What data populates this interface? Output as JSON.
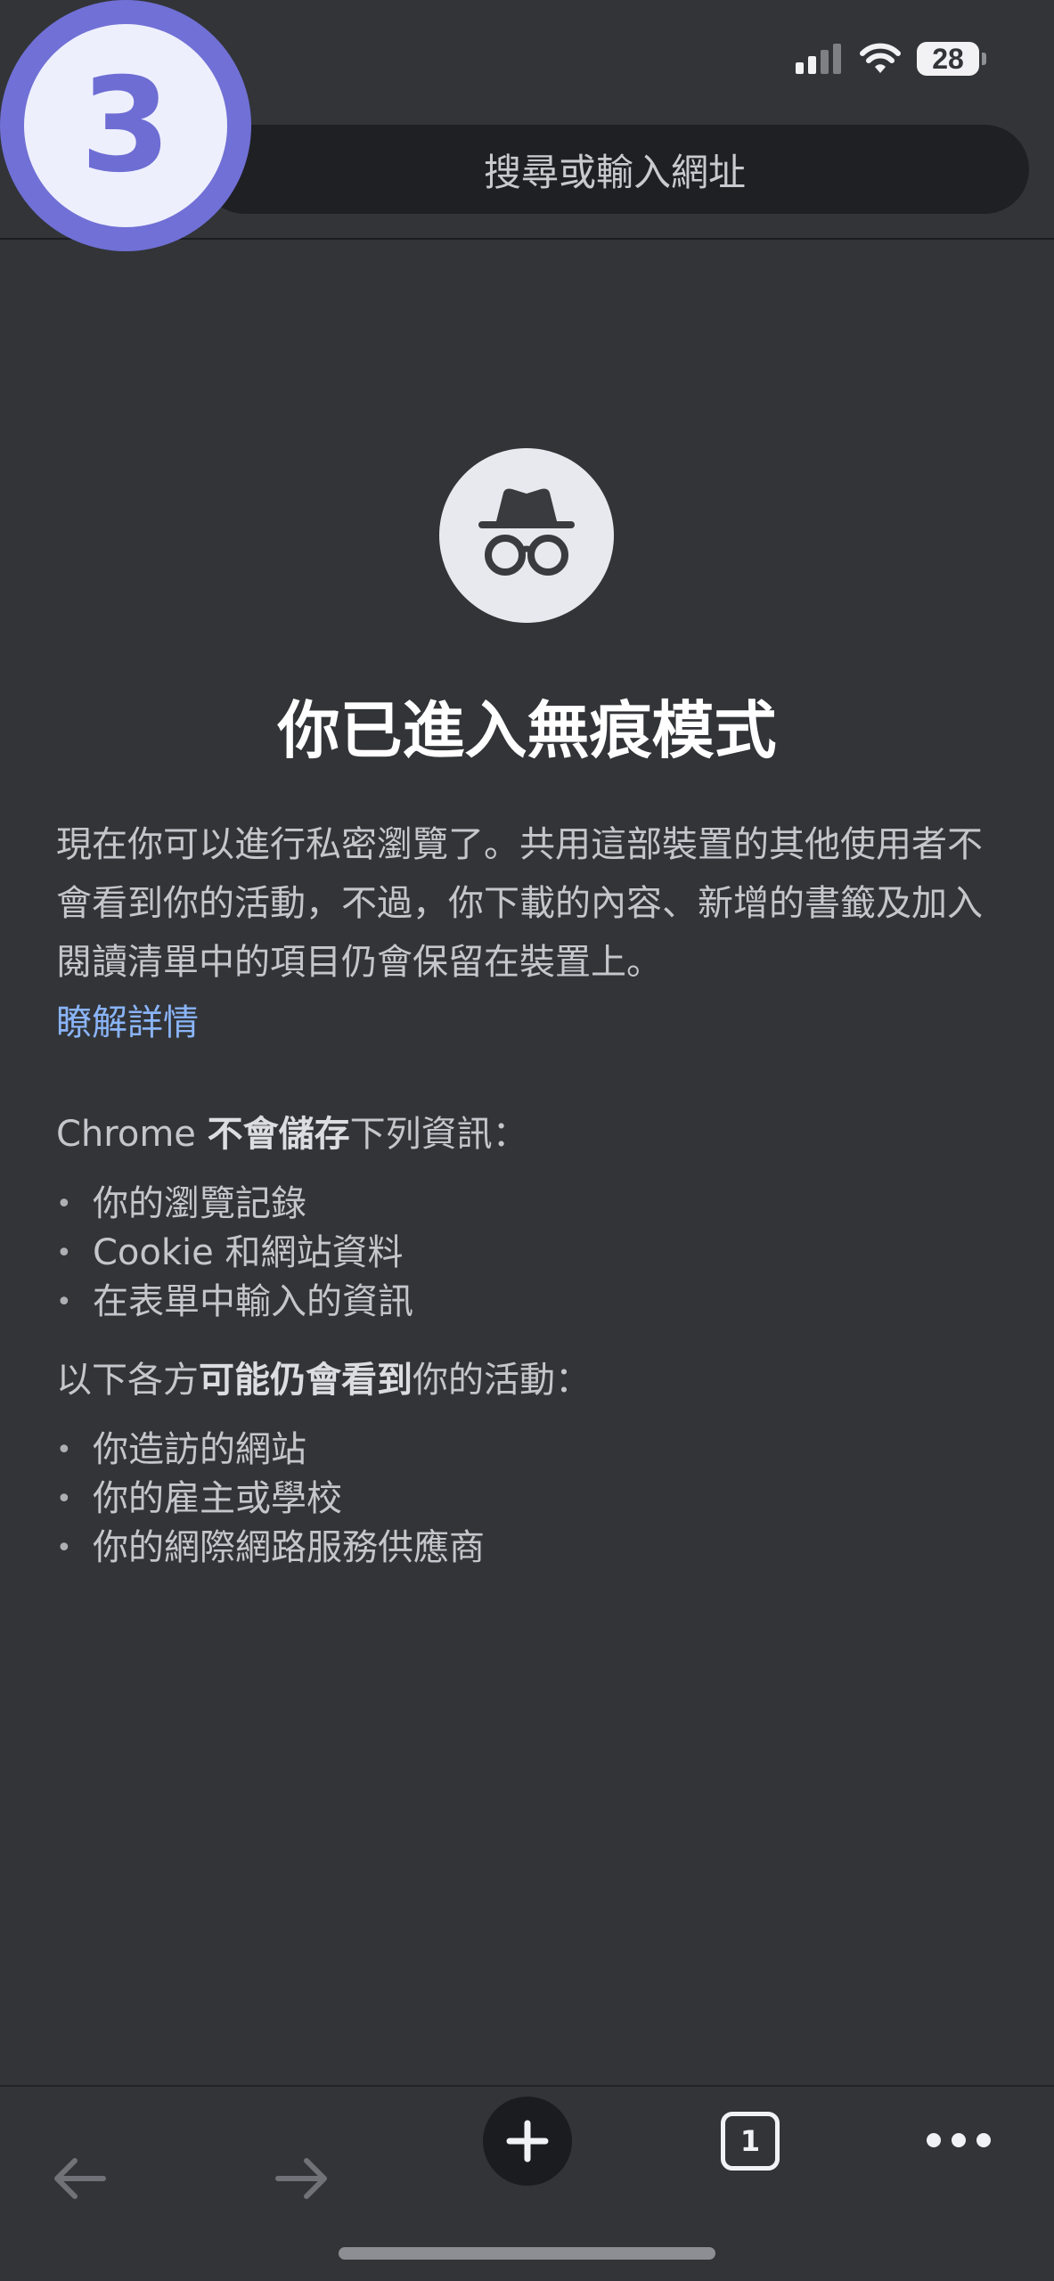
{
  "status_bar": {
    "battery": "28"
  },
  "step_badge": {
    "number": "3"
  },
  "address_bar": {
    "placeholder": "搜尋或輸入網址"
  },
  "incognito": {
    "icon": "incognito-icon",
    "title": "你已進入無痕模式",
    "intro": "現在你可以進行私密瀏覽了。共用這部裝置的其他使用者不會看到你的活動，不過，你下載的內容、新增的書籤及加入閱讀清單中的項目仍會保留在裝置上。",
    "learn_more": "瞭解詳情",
    "not_saved": {
      "prefix": "Chrome ",
      "emphasis": "不會儲存",
      "suffix": "下列資訊："
    },
    "not_saved_items": [
      "你的瀏覽記錄",
      "Cookie 和網站資料",
      "在表單中輸入的資訊"
    ],
    "may_see": {
      "prefix": "以下各方",
      "emphasis": "可能仍會看到",
      "suffix": "你的活動："
    },
    "may_see_items": [
      "你造訪的網站",
      "你的雇主或學校",
      "你的網際網路服務供應商"
    ]
  },
  "bottom_toolbar": {
    "back_icon": "back-arrow-icon",
    "forward_icon": "forward-arrow-icon",
    "new_tab_icon": "plus-icon",
    "tab_count": "1",
    "menu_icon": "more-dots-icon"
  },
  "colors": {
    "background": "#323438",
    "link": "#8ab4f8",
    "badge_ring": "#7070d6"
  }
}
